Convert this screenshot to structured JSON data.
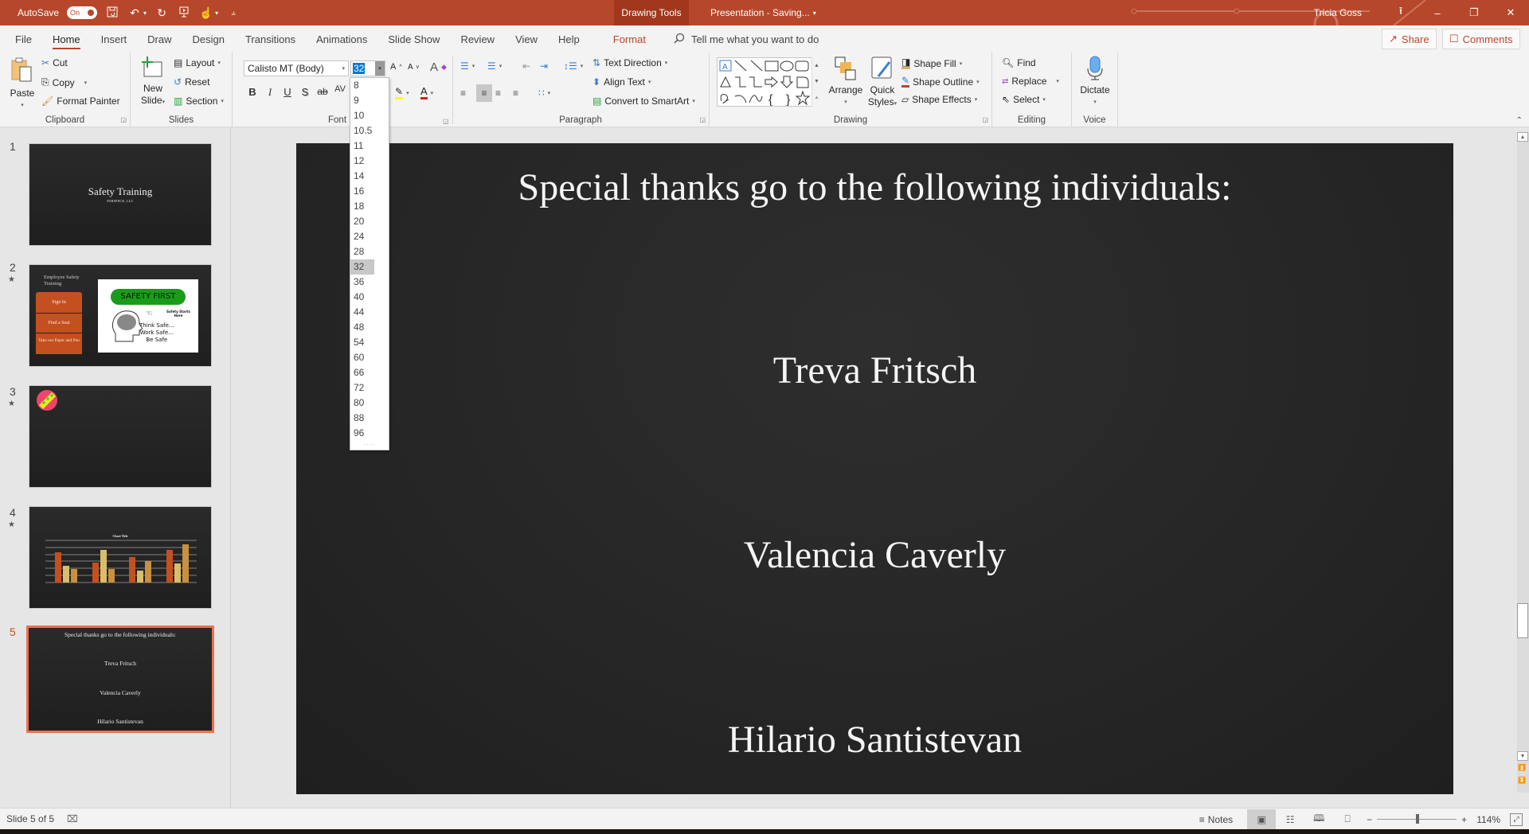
{
  "titlebar": {
    "autosave_label": "AutoSave",
    "autosave_state": "On",
    "contextual_tab": "Drawing Tools",
    "document_title": "Presentation  -  Saving...",
    "user_name": "Tricia Goss",
    "icons": [
      "save-icon",
      "undo-icon",
      "redo-icon",
      "start-presentation-icon",
      "touch-mode-icon",
      "customize-qat-icon"
    ]
  },
  "tabs": [
    {
      "label": "File"
    },
    {
      "label": "Home",
      "active": true
    },
    {
      "label": "Insert"
    },
    {
      "label": "Draw"
    },
    {
      "label": "Design"
    },
    {
      "label": "Transitions"
    },
    {
      "label": "Animations"
    },
    {
      "label": "Slide Show"
    },
    {
      "label": "Review"
    },
    {
      "label": "View"
    },
    {
      "label": "Help"
    }
  ],
  "format_tab": "Format",
  "tell_me_placeholder": "Tell me what you want to do",
  "share_label": "Share",
  "comments_label": "Comments",
  "ribbon": {
    "clipboard": {
      "label": "Clipboard",
      "paste": "Paste",
      "cut": "Cut",
      "copy": "Copy",
      "format_painter": "Format Painter"
    },
    "slides": {
      "label": "Slides",
      "new_slide_1": "New",
      "new_slide_2": "Slide",
      "layout": "Layout",
      "reset": "Reset",
      "section": "Section"
    },
    "font": {
      "label": "Font",
      "font_name": "Calisto MT (Body)",
      "font_size": "32",
      "bold": "B",
      "italic": "I",
      "underline": "U",
      "shadow": "S",
      "strike": "ab",
      "spacing": "AV",
      "font_color_hex": "#e01b1b",
      "highlight_hex": "#ffff00"
    },
    "paragraph": {
      "label": "Paragraph",
      "text_direction": "Text Direction",
      "align_text": "Align Text",
      "smartart": "Convert to SmartArt"
    },
    "drawing": {
      "label": "Drawing",
      "arrange": "Arrange",
      "quick_styles_1": "Quick",
      "quick_styles_2": "Styles",
      "shape_fill": "Shape Fill",
      "shape_outline": "Shape Outline",
      "shape_effects": "Shape Effects"
    },
    "editing": {
      "label": "Editing",
      "find": "Find",
      "replace": "Replace",
      "select": "Select"
    },
    "voice": {
      "label": "Voice",
      "dictate": "Dictate"
    }
  },
  "font_size_dropdown": {
    "options": [
      "8",
      "9",
      "10",
      "10.5",
      "11",
      "12",
      "14",
      "16",
      "18",
      "20",
      "24",
      "28",
      "32",
      "36",
      "40",
      "44",
      "48",
      "54",
      "60",
      "66",
      "72",
      "80",
      "88",
      "96"
    ],
    "selected": "32"
  },
  "slides": [
    {
      "number": "1",
      "starred": false,
      "title": "Safety Training",
      "subtitle": "PARSPECK, LLC"
    },
    {
      "number": "2",
      "starred": true,
      "title": "Employee Safety Training",
      "steps": [
        "Sign In",
        "Find a Seat",
        "Take out Paper and Pen"
      ],
      "poster_heading": "SAFETY FIRST",
      "poster_tag": "Safety Starts Here",
      "poster_lines": [
        "Think Safe...",
        "Work Safe...",
        "Be Safe"
      ]
    },
    {
      "number": "3",
      "starred": true
    },
    {
      "number": "4",
      "starred": true,
      "chart_title": "Chart Title"
    },
    {
      "number": "5",
      "starred": false,
      "selected": true,
      "title": "Special thanks go to the following individuals:",
      "names": [
        "Treva Fritsch",
        "Valencia Caverly",
        "Hilario Santistevan"
      ]
    }
  ],
  "current_slide": {
    "title": "Special thanks go to the following individuals:",
    "names": [
      "Treva Fritsch",
      "Valencia Caverly",
      "Hilario Santistevan"
    ]
  },
  "statusbar": {
    "slide_info": "Slide 5 of 5",
    "notes_label": "Notes",
    "zoom_level": "114%",
    "accent_hex": "#b7472a"
  }
}
